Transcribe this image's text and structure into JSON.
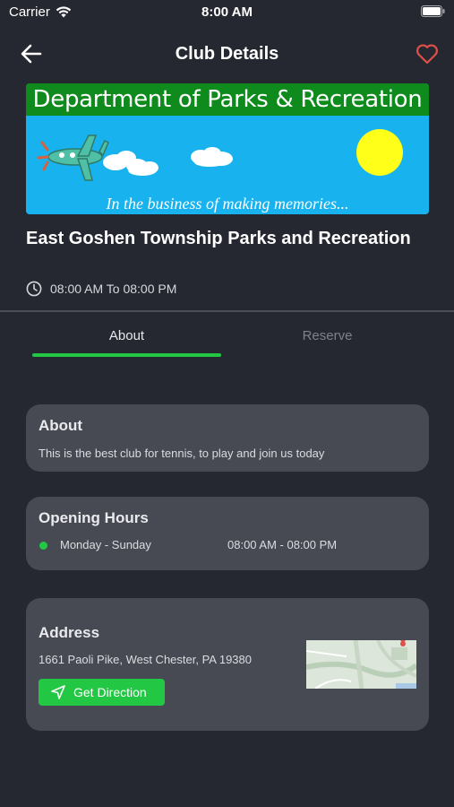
{
  "status": {
    "carrier": "Carrier",
    "time": "8:00 AM"
  },
  "header": {
    "title": "Club Details",
    "back_icon": "arrow-left-icon",
    "favorite_icon": "heart-icon"
  },
  "banner": {
    "heading": "Department of Parks & Recreation",
    "tagline": "In the business of making memories..."
  },
  "club": {
    "name": "East Goshen Township Parks and Recreation",
    "hours": "08:00 AM To 08:00 PM"
  },
  "tabs": [
    {
      "label": "About",
      "active": true
    },
    {
      "label": "Reserve",
      "active": false
    }
  ],
  "about": {
    "title": "About",
    "text": "This is the best club for tennis, to play and join us today"
  },
  "opening_hours": {
    "title": "Opening Hours",
    "days": "Monday - Sunday",
    "range": "08:00 AM - 08:00 PM"
  },
  "address": {
    "title": "Address",
    "text": "1661 Paoli Pike, West Chester, PA 19380",
    "button_label": "Get Direction"
  },
  "colors": {
    "background": "#252830",
    "card": "#474a52",
    "accent": "#22c744",
    "heart": "#e0504a"
  }
}
